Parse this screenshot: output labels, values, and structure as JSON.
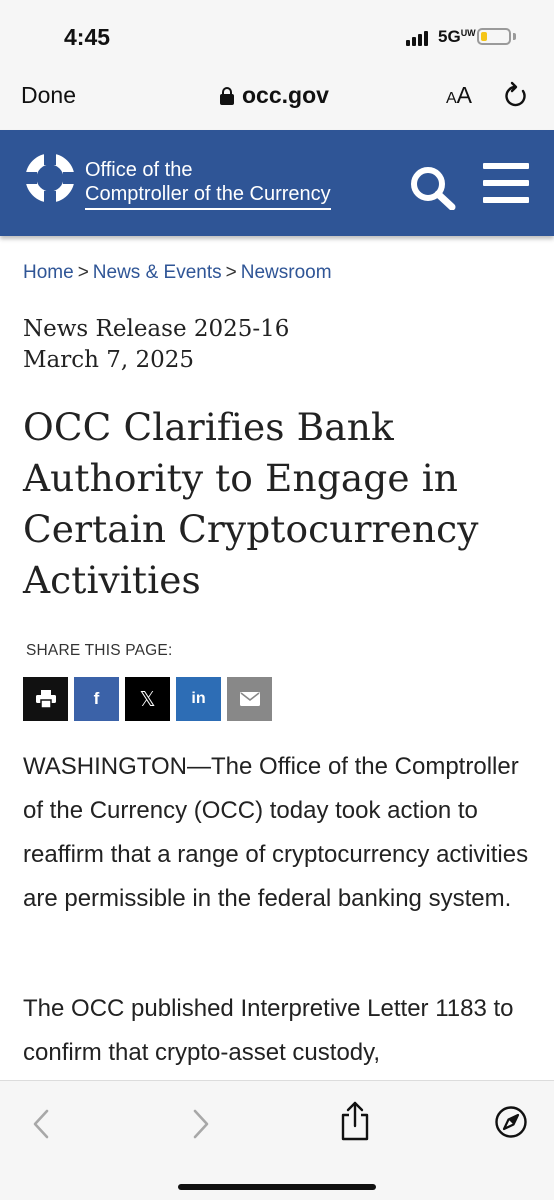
{
  "status_bar": {
    "time": "4:45",
    "network": "5G",
    "network_suffix": "UW",
    "battery_level": 0.2,
    "battery_color": "#f5c518"
  },
  "browser": {
    "done_label": "Done",
    "url": "occ.gov",
    "text_size_small": "A",
    "text_size_big": "A",
    "icons": [
      "lock-icon",
      "reload-icon",
      "back-icon",
      "forward-icon",
      "share-icon",
      "safari-compass-icon"
    ]
  },
  "header": {
    "org_line1": "Office of the",
    "org_line2": "Comptroller of the Currency",
    "bg_color": "#2f5596",
    "icons": [
      "occ-logo",
      "search-icon",
      "menu-icon"
    ]
  },
  "breadcrumb": {
    "items": [
      "Home",
      "News & Events",
      "Newsroom"
    ],
    "separator": ">"
  },
  "article": {
    "release_number": "News Release 2025-16",
    "date": "March 7, 2025",
    "title": "OCC Clarifies Bank Authority to Engage in Certain Cryptocurrency Activities",
    "share_label": "SHARE THIS PAGE:",
    "share_buttons": [
      {
        "name": "print",
        "label": "",
        "color": "#111111"
      },
      {
        "name": "facebook",
        "label": "f",
        "color": "#3b62a8"
      },
      {
        "name": "x",
        "label": "𝕏",
        "color": "#000000"
      },
      {
        "name": "linkedin",
        "label": "in",
        "color": "#2d6db5"
      },
      {
        "name": "email",
        "label": "",
        "color": "#888888"
      }
    ],
    "paragraphs": [
      "WASHINGTON—The Office of the Comptroller of the Currency (OCC) today took action to reaffirm that a range of cryptocurrency activities are permissible in the federal banking system.",
      "The OCC published Interpretive Letter 1183 to confirm that crypto-asset custody,"
    ]
  }
}
